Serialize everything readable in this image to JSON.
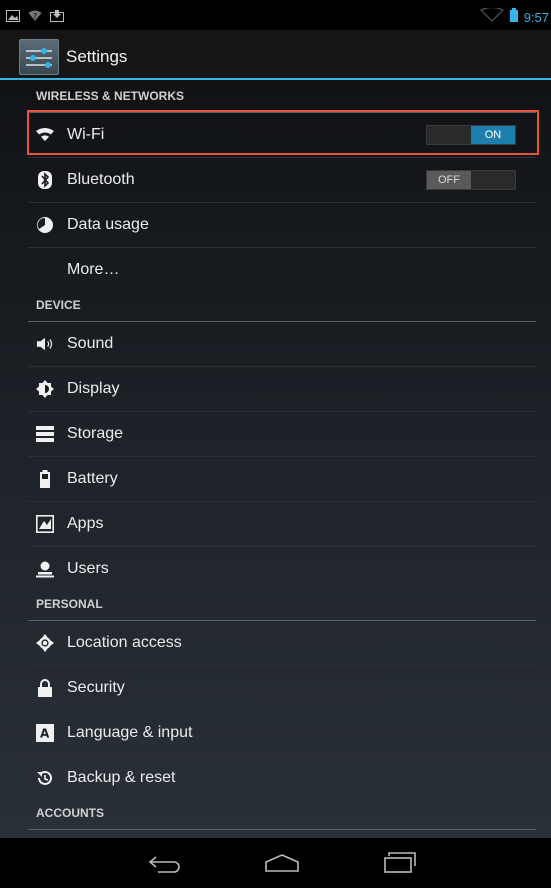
{
  "status_bar": {
    "time": "9:57",
    "icons": [
      "image-notification-icon",
      "wifi-unknown-icon",
      "download-icon",
      "signal-icon",
      "battery-icon"
    ]
  },
  "action_bar": {
    "title": "Settings",
    "icon": "settings-app-icon"
  },
  "sections": [
    {
      "header": "WIRELESS & NETWORKS",
      "items": [
        {
          "label": "Wi-Fi",
          "icon": "wifi-icon",
          "switch": "ON"
        },
        {
          "label": "Bluetooth",
          "icon": "bluetooth-icon",
          "switch": "OFF"
        },
        {
          "label": "Data usage",
          "icon": "data-usage-icon"
        },
        {
          "label": "More…"
        }
      ]
    },
    {
      "header": "DEVICE",
      "items": [
        {
          "label": "Sound",
          "icon": "sound-icon"
        },
        {
          "label": "Display",
          "icon": "display-icon"
        },
        {
          "label": "Storage",
          "icon": "storage-icon"
        },
        {
          "label": "Battery",
          "icon": "battery-icon"
        },
        {
          "label": "Apps",
          "icon": "apps-icon"
        },
        {
          "label": "Users",
          "icon": "users-icon"
        }
      ]
    },
    {
      "header": "PERSONAL",
      "items": [
        {
          "label": "Location access",
          "icon": "location-icon"
        },
        {
          "label": "Security",
          "icon": "lock-icon"
        },
        {
          "label": "Language & input",
          "icon": "keyboard-icon"
        },
        {
          "label": "Backup & reset",
          "icon": "backup-icon"
        }
      ]
    },
    {
      "header": "ACCOUNTS",
      "items": []
    }
  ],
  "colors": {
    "accent": "#33b5e5",
    "switch_on": "#1e7fae",
    "highlight": "#e8553e"
  },
  "nav_bar": {
    "icons": [
      "back-icon",
      "home-icon",
      "recent-apps-icon"
    ]
  }
}
